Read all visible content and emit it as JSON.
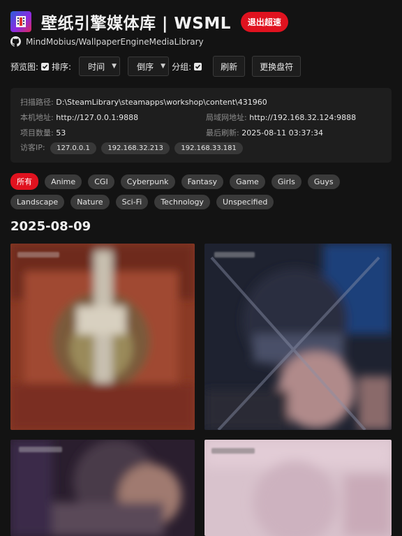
{
  "header": {
    "title": "壁纸引擎媒体库 | WSML",
    "exit_label": "退出超速"
  },
  "repo": {
    "name": "MindMobius/WallpaperEngineMediaLibrary"
  },
  "toolbar": {
    "preview_label": "预览图:",
    "sort_label": "排序:",
    "sort_field": "时间",
    "sort_order": "倒序",
    "group_label": "分组:",
    "refresh_label": "刷新",
    "change_disk_label": "更换盘符"
  },
  "info": {
    "scan_path_label": "扫描路径:",
    "scan_path": "D:\\SteamLibrary\\steamapps\\workshop\\content\\431960",
    "local_addr_label": "本机地址:",
    "local_addr": "http://127.0.0.1:9888",
    "lan_addr_label": "局域网地址:",
    "lan_addr": "http://192.168.32.124:9888",
    "item_count_label": "项目数量:",
    "item_count": "53",
    "last_refresh_label": "最后刷新:",
    "last_refresh": "2025-08-11 03:37:34",
    "visitor_ip_label": "访客IP:",
    "visitor_ips": [
      "127.0.0.1",
      "192.168.32.213",
      "192.168.33.181"
    ]
  },
  "tags": [
    "所有",
    "Anime",
    "CGI",
    "Cyberpunk",
    "Fantasy",
    "Game",
    "Girls",
    "Guys",
    "Landscape",
    "Nature",
    "Sci-Fi",
    "Technology",
    "Unspecified"
  ],
  "active_tag": "所有",
  "group_date": "2025-08-09",
  "colors": {
    "accent": "#e0121f",
    "background": "#131313",
    "panel": "#1e1e1e"
  }
}
